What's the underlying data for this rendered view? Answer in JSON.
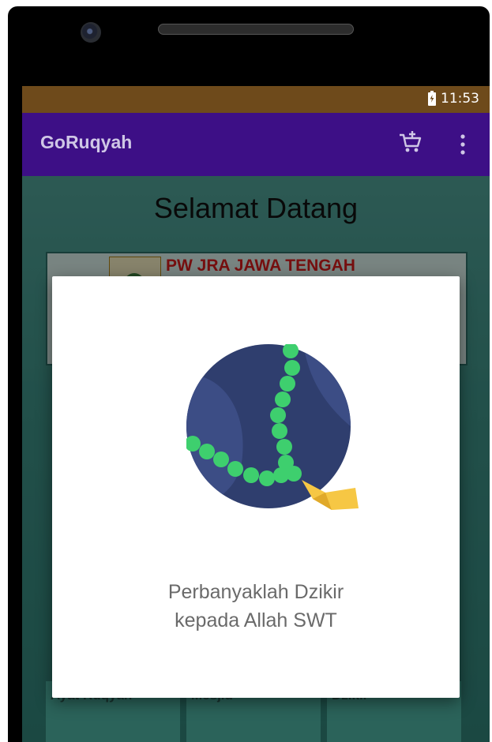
{
  "status_bar": {
    "time": "11:53"
  },
  "app_bar": {
    "title": "GoRuqyah",
    "cart_icon": "cart-plus-icon",
    "menu_icon": "more-vert-icon"
  },
  "home": {
    "heading": "Selamat Datang",
    "banner": {
      "text": "PW JRA JAWA TENGAH"
    },
    "tiles": [
      {
        "label": "Ayat Ruqyah"
      },
      {
        "label": "Mesjid"
      },
      {
        "label": "Dzikir"
      }
    ]
  },
  "dialog": {
    "illustration": "prayer-beads-icon",
    "line1": "Perbanyaklah Dzikir",
    "line2": "kepada Allah SWT"
  },
  "colors": {
    "status_bar": "#6e4a1b",
    "app_bar": "#3d0f86",
    "content": "#3b8a80",
    "beads": "#3ecf6e",
    "circle": "#2f3e6e"
  }
}
